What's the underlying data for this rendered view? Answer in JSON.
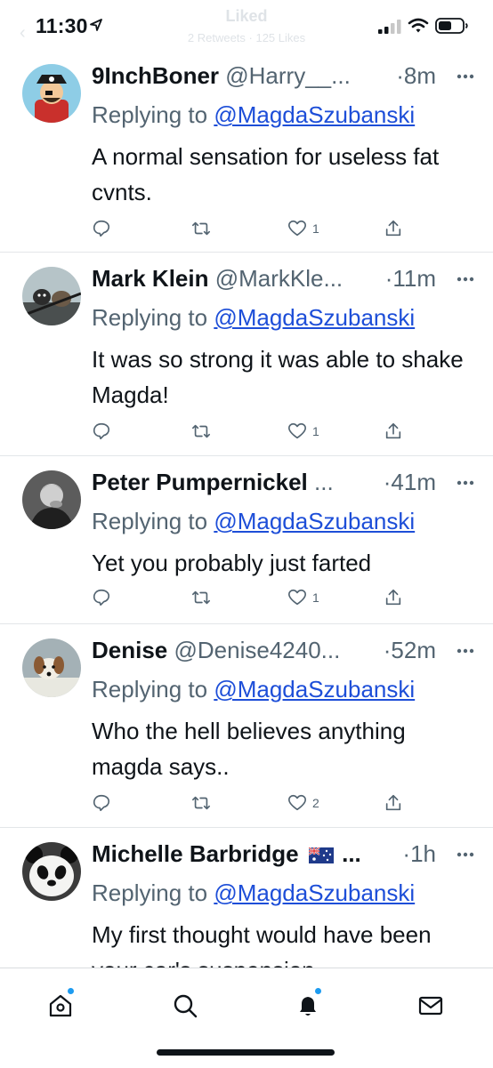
{
  "status_bar": {
    "time": "11:30"
  },
  "faded_header": {
    "title": "Liked",
    "subtitle": "2 Retweets · 125 Likes"
  },
  "tweets": [
    {
      "name": "9InchBoner",
      "handle": "@Harry__...",
      "time": "·8m",
      "replying_prefix": "Replying to",
      "replying_to": "@MagdaSzubanski",
      "text": "A normal sensation for useless fat cvnts.",
      "likes": "1",
      "avatar": "pirate-avatar"
    },
    {
      "name": "Mark Klein",
      "handle": "@MarkKle...",
      "time": "·11m",
      "replying_prefix": "Replying to",
      "replying_to": "@MagdaSzubanski",
      "text": "It was so strong it was able to shake Magda!",
      "likes": "1",
      "avatar": "dogs-avatar"
    },
    {
      "name": "Peter Pumpernickel",
      "handle": "...",
      "time": "·41m",
      "replying_prefix": "Replying to",
      "replying_to": "@MagdaSzubanski",
      "text": "Yet you probably just farted",
      "likes": "1",
      "avatar": "man-avatar"
    },
    {
      "name": "Denise",
      "handle": "@Denise4240...",
      "time": "·52m",
      "replying_prefix": "Replying to",
      "replying_to": "@MagdaSzubanski",
      "text": "Who the hell believes anything magda says..",
      "likes": "2",
      "avatar": "dog-avatar"
    },
    {
      "name": "Michelle Barbridge",
      "handle": "...",
      "time": "·1h",
      "replying_prefix": "Replying to",
      "replying_to": "@MagdaSzubanski",
      "text": "My first thought would have been your car's suspension",
      "likes": "",
      "avatar": "panda-avatar"
    }
  ],
  "nav": {
    "items": [
      "home-icon",
      "search-icon",
      "notifications-icon",
      "messages-icon"
    ]
  },
  "colors": {
    "link": "#1d4ed8",
    "muted": "#536471",
    "accent": "#1d9bf0"
  }
}
